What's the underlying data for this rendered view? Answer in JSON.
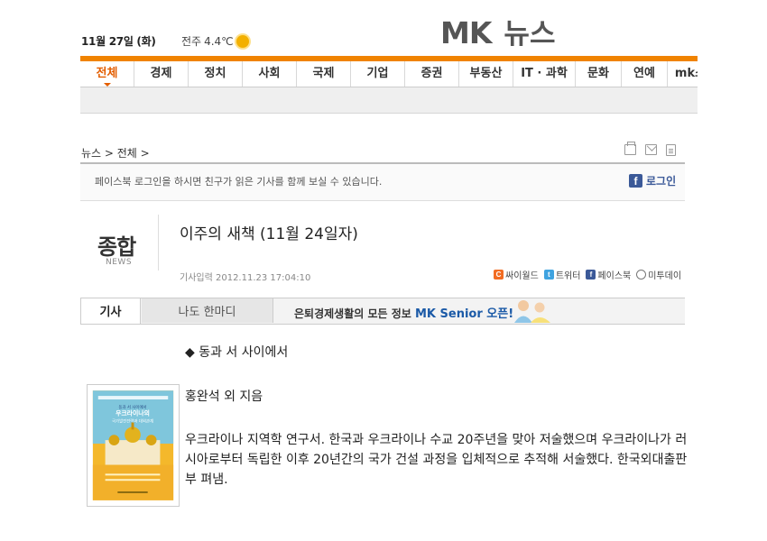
{
  "header": {
    "date": "11월 27일 (화)",
    "weather_city": "전주",
    "weather_temp": "4.4℃",
    "logo_mk": "MK",
    "logo_news": "뉴스"
  },
  "nav": {
    "items": [
      "전체",
      "경제",
      "정치",
      "사회",
      "국제",
      "기업",
      "증권",
      "부동산",
      "IT · 과학",
      "문화",
      "연예",
      "mk스"
    ],
    "active": "전체"
  },
  "breadcrumb": "뉴스 > 전체 >",
  "facebook": {
    "notice": "페이스북 로그인을 하시면 친구가 읽은 기사를 함께 보실 수 있습니다.",
    "login_label": "로그인"
  },
  "section": {
    "name": "종합",
    "name_en": "NEWS"
  },
  "article": {
    "title": "이주의 새책 (11월 24일자)",
    "meta": "기사입력 2012.11.23 17:04:10",
    "subhead": "◆ 동과 서 사이에서",
    "author": "홍완석 외 지음",
    "body": "우크라이나 지역학 연구서. 한국과 우크라이나 수교 20주년을 맞아 저술했으며 우크라이나가 러시아로부터 독립한 이후 20년간의 국가 건설 과정을 입체적으로 추적해 서술했다. 한국외대출판부 펴냄."
  },
  "share": {
    "cyworld": "싸이월드",
    "twitter": "트위터",
    "facebook": "페이스북",
    "me2day": "미투데이"
  },
  "tabs": {
    "article": "기사",
    "comment": "나도 한마디"
  },
  "promo": {
    "text": "은퇴경제생활의 모든 정보",
    "highlight": "MK Senior 오픈!"
  },
  "book_cover": {
    "line1": "동과 서 사이에서",
    "line2": "우크라이나의",
    "line3": "국가발전전략과 대외관계"
  },
  "colors": {
    "accent": "#f08300",
    "nav_active": "#e35d00",
    "facebook": "#3b5998"
  }
}
